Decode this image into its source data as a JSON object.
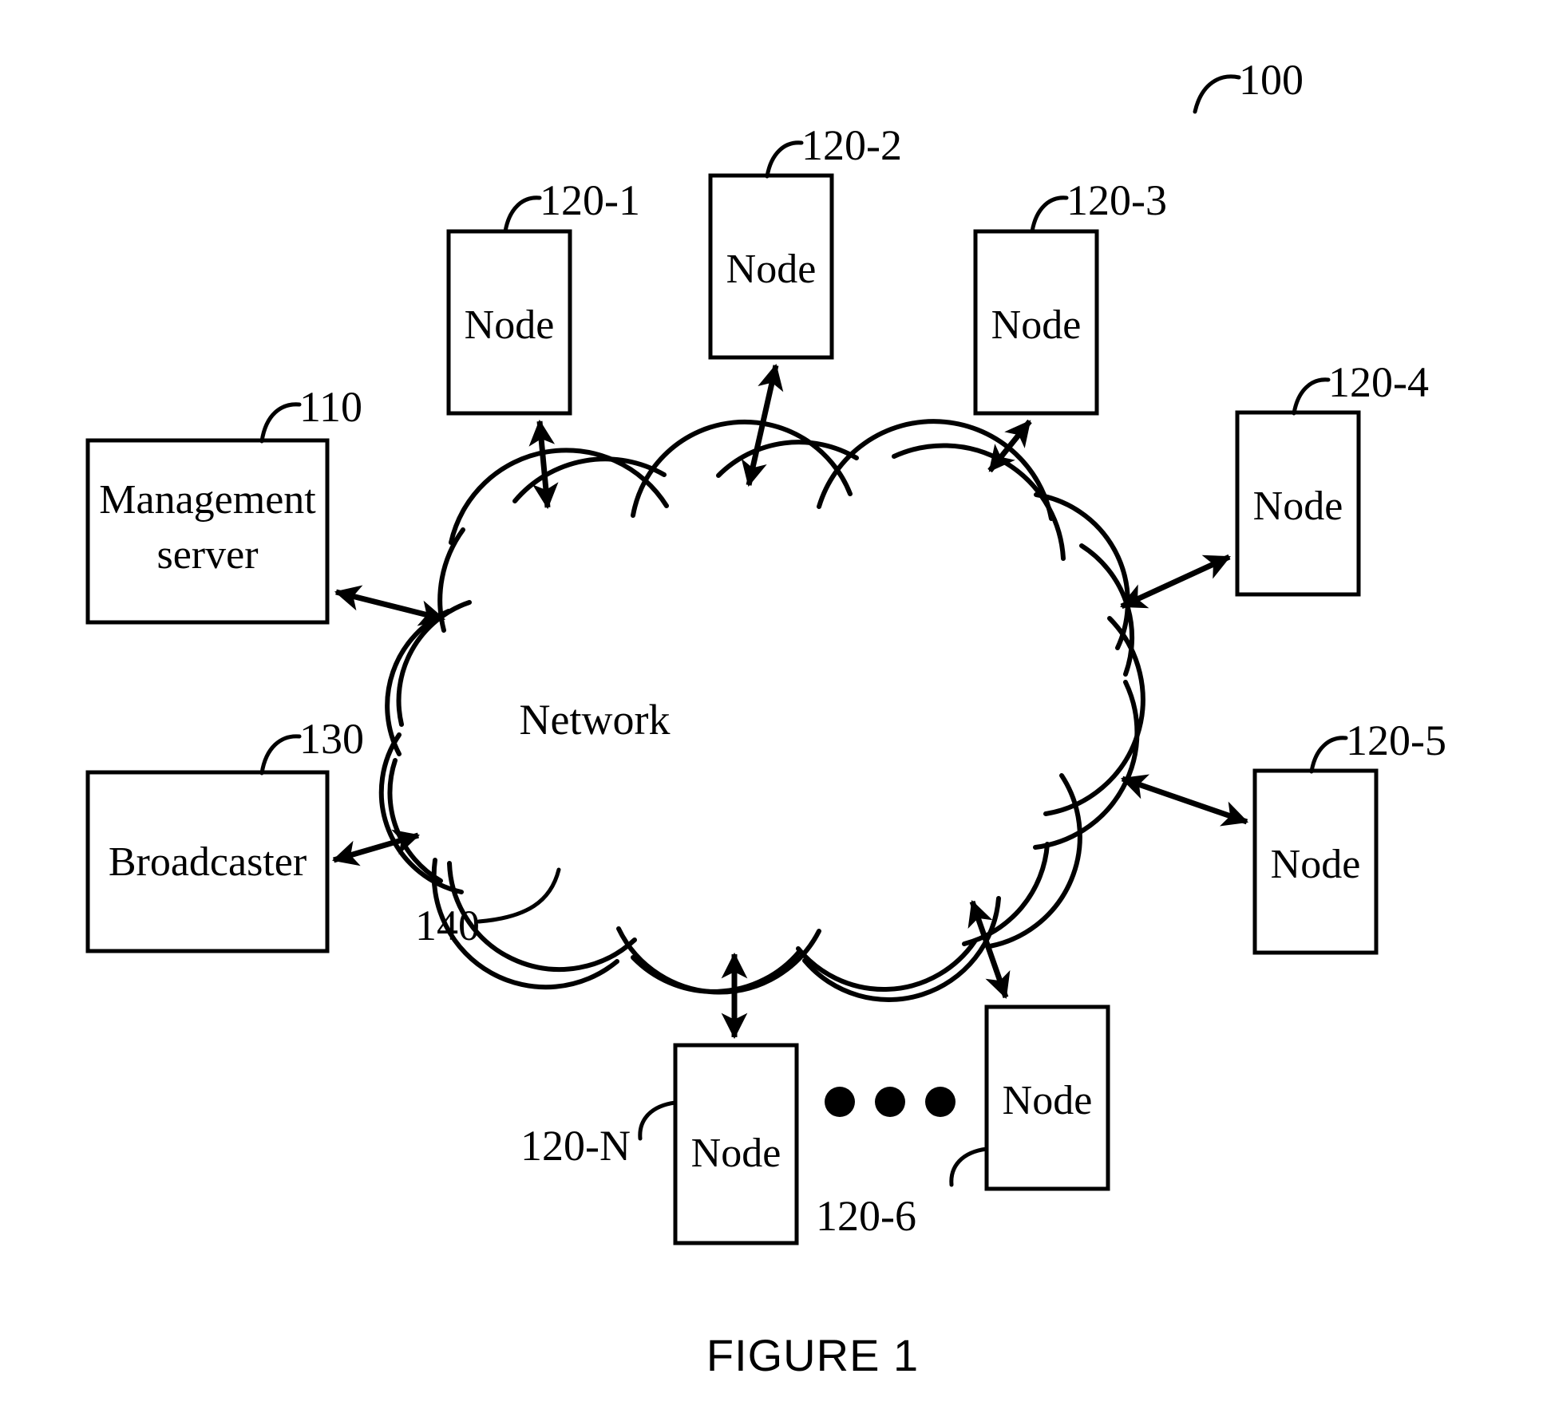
{
  "figure": {
    "caption": "FIGURE 1",
    "system_ref": "100"
  },
  "cloud": {
    "label": "Network",
    "ref": "140"
  },
  "boxes": [
    {
      "id": "management-server",
      "label_line1": "Management",
      "label_line2": "server",
      "ref": "110"
    },
    {
      "id": "broadcaster",
      "label": "Broadcaster",
      "ref": "130"
    },
    {
      "id": "node-120-1",
      "label": "Node",
      "ref": "120-1"
    },
    {
      "id": "node-120-2",
      "label": "Node",
      "ref": "120-2"
    },
    {
      "id": "node-120-3",
      "label": "Node",
      "ref": "120-3"
    },
    {
      "id": "node-120-4",
      "label": "Node",
      "ref": "120-4"
    },
    {
      "id": "node-120-5",
      "label": "Node",
      "ref": "120-5"
    },
    {
      "id": "node-120-6",
      "label": "Node",
      "ref": "120-6"
    },
    {
      "id": "node-120-n",
      "label": "Node",
      "ref": "120-N"
    }
  ],
  "ellipsis": {
    "count": 3,
    "meaning": "additional nodes"
  },
  "colors": {
    "stroke": "#000000",
    "fill": "#ffffff",
    "background": "#ffffff"
  }
}
